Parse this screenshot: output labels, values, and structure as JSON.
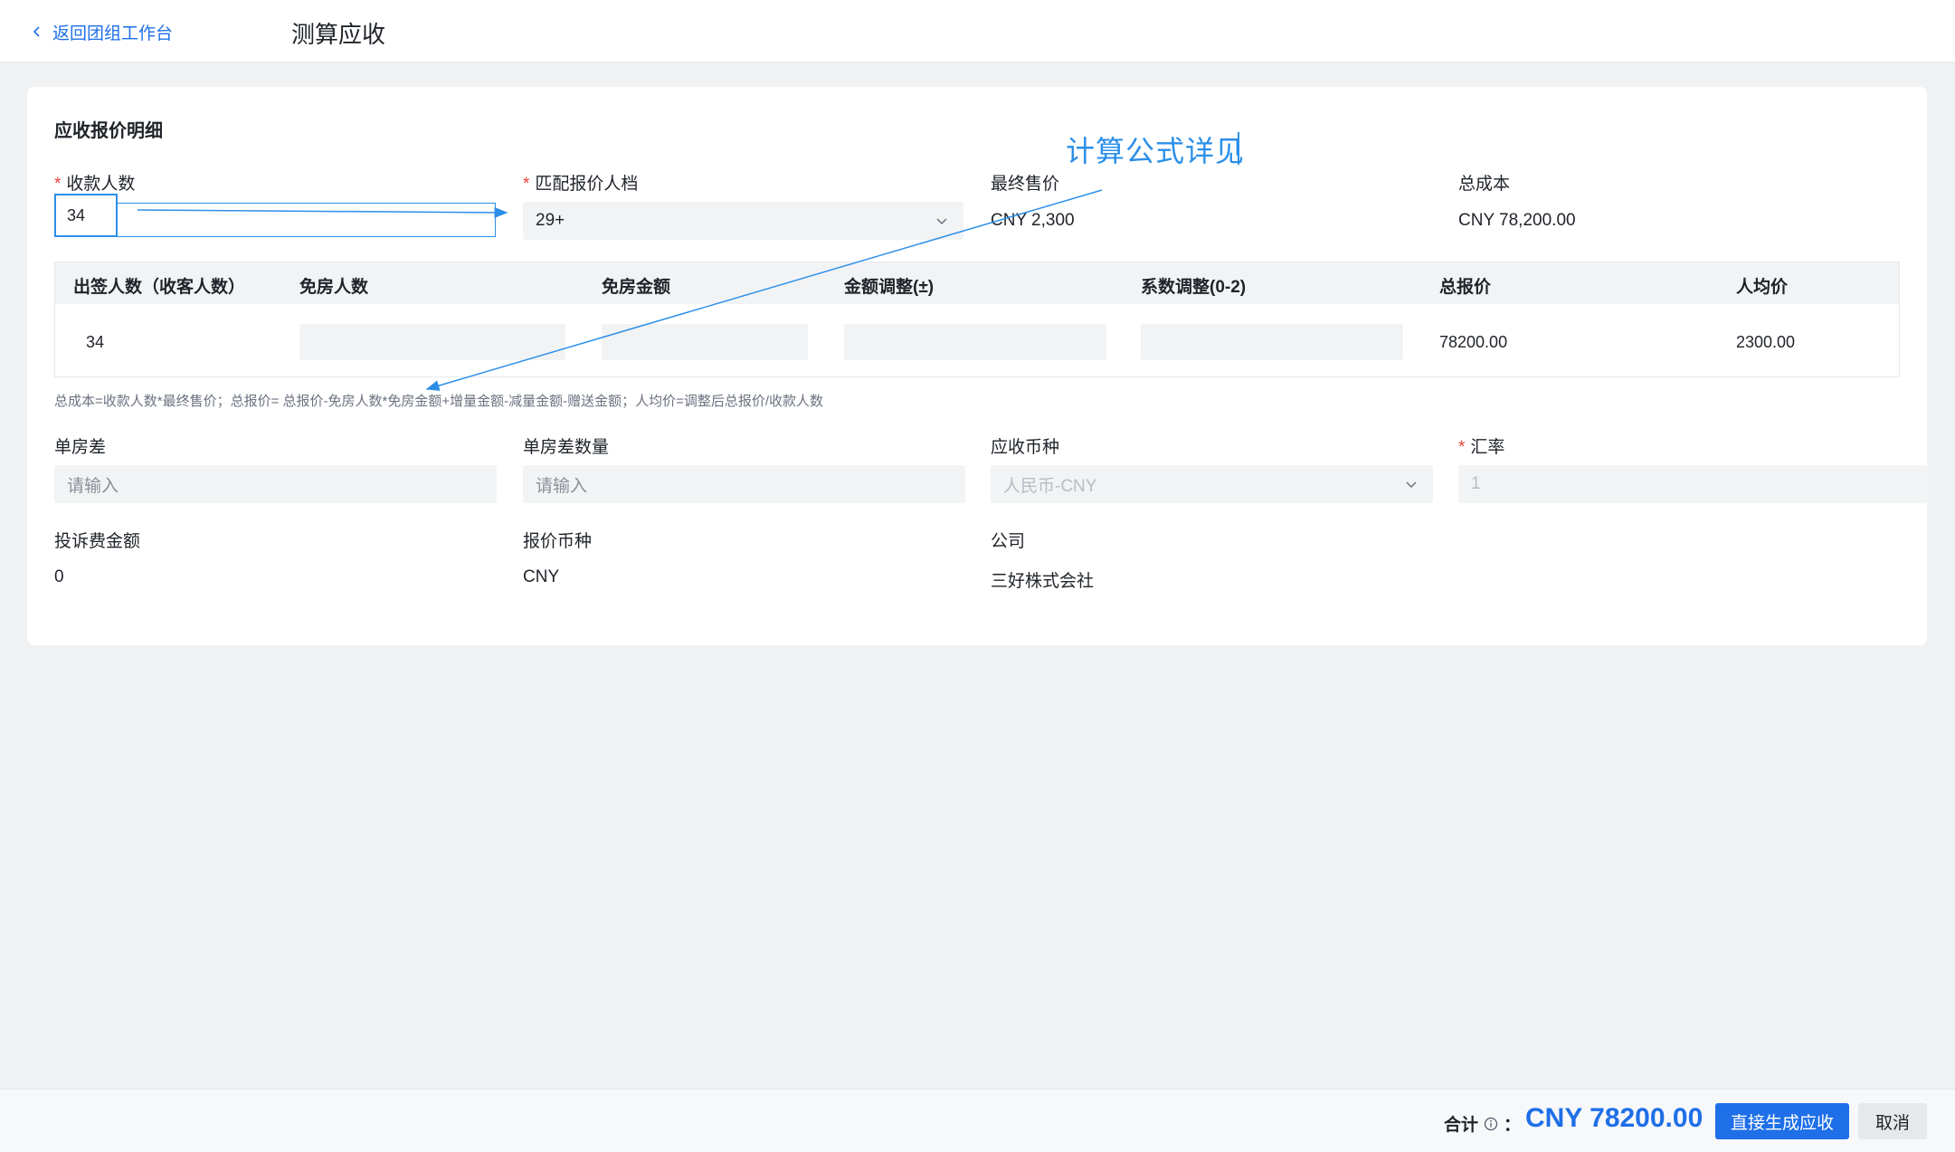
{
  "header": {
    "back_label": "返回团组工作台",
    "title": "测算应收"
  },
  "card": {
    "section_title": "应收报价明细",
    "annotation": "计算公式详见",
    "fields_row1": {
      "people_label": "收款人数",
      "people_value": "34",
      "tier_label": "匹配报价人档",
      "tier_value": "29+",
      "final_price_label": "最终售价",
      "final_price_value": "CNY 2,300",
      "total_cost_label": "总成本",
      "total_cost_value": "CNY 78,200.00"
    },
    "table": {
      "headers": [
        "出签人数（收客人数）",
        "免房人数",
        "免房金额",
        "金额调整(±)",
        "系数调整(0-2)",
        "总报价",
        "人均价"
      ],
      "row": {
        "visa_count": "34",
        "total_quote": "78200.00",
        "per_person": "2300.00"
      }
    },
    "formula": "总成本=收款人数*最终售价；总报价= 总报价-免房人数*免房金额+增量金额-减量金额-赠送金额；人均价=调整后总报价/收款人数",
    "fields_row2": {
      "single_room_label": "单房差",
      "single_room_placeholder": "请输入",
      "single_room_qty_label": "单房差数量",
      "single_room_qty_placeholder": "请输入",
      "currency_label": "应收币种",
      "currency_value": "人民币-CNY",
      "rate_label": "汇率",
      "rate_value": "1"
    },
    "fields_row3": {
      "complaint_label": "投诉费金额",
      "complaint_value": "0",
      "quote_currency_label": "报价币种",
      "quote_currency_value": "CNY",
      "company_label": "公司",
      "company_value": "三好株式会社"
    }
  },
  "footer": {
    "total_label": "合计",
    "total_colon": "：",
    "total_value": "CNY 78200.00",
    "primary_button": "直接生成应收",
    "cancel_button": "取消"
  },
  "colors": {
    "accent": "#1e6fe8",
    "annotation": "#2b8fe8",
    "required": "#e8433a"
  }
}
